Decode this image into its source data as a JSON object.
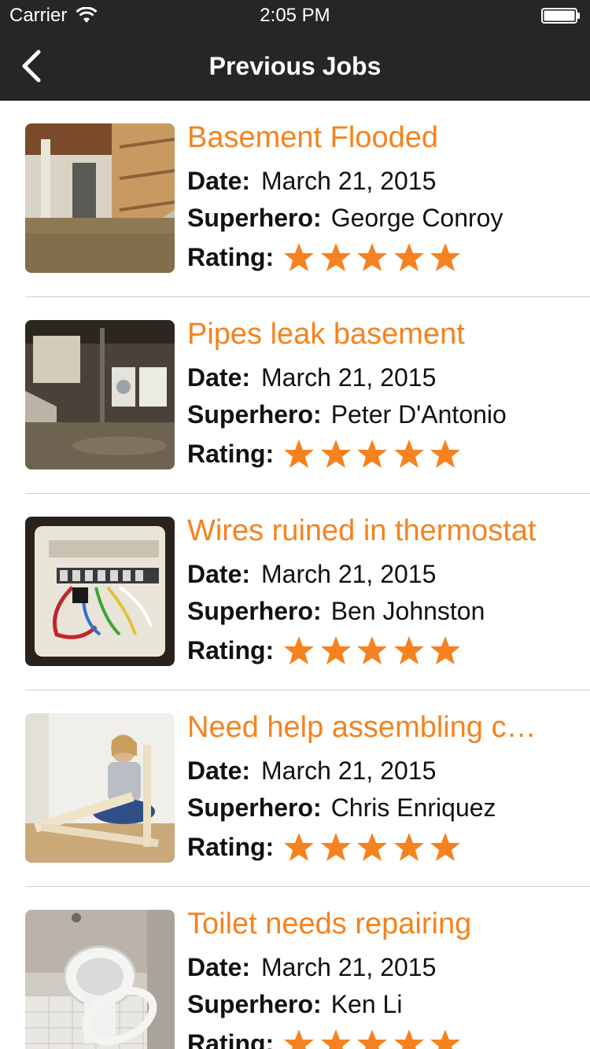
{
  "status_bar": {
    "carrier": "Carrier",
    "time": "2:05 PM"
  },
  "nav": {
    "title": "Previous Jobs",
    "back_icon": "chevron-left-icon"
  },
  "labels": {
    "date": "Date:",
    "superhero": "Superhero:",
    "rating": "Rating:"
  },
  "colors": {
    "accent": "#f5821f",
    "bar": "#262626",
    "star": "#f5821f"
  },
  "jobs": [
    {
      "title": "Basement Flooded",
      "date": "March 21, 2015",
      "superhero": "George Conroy",
      "rating": 5,
      "image": "flooded-basement"
    },
    {
      "title": "Pipes leak basement",
      "date": "March 21, 2015",
      "superhero": "Peter D'Antonio",
      "rating": 5,
      "image": "leaking-basement"
    },
    {
      "title": "Wires ruined in thermostat",
      "date": "March 21, 2015",
      "superhero": "Ben Johnston",
      "rating": 5,
      "image": "thermostat-wires"
    },
    {
      "title": "Need help assembling c…",
      "date": "March 21, 2015",
      "superhero": "Chris Enriquez",
      "rating": 5,
      "image": "furniture-assembly"
    },
    {
      "title": "Toilet needs repairing",
      "date": "March 21, 2015",
      "superhero": "Ken Li",
      "rating": 5,
      "image": "broken-toilet"
    }
  ]
}
